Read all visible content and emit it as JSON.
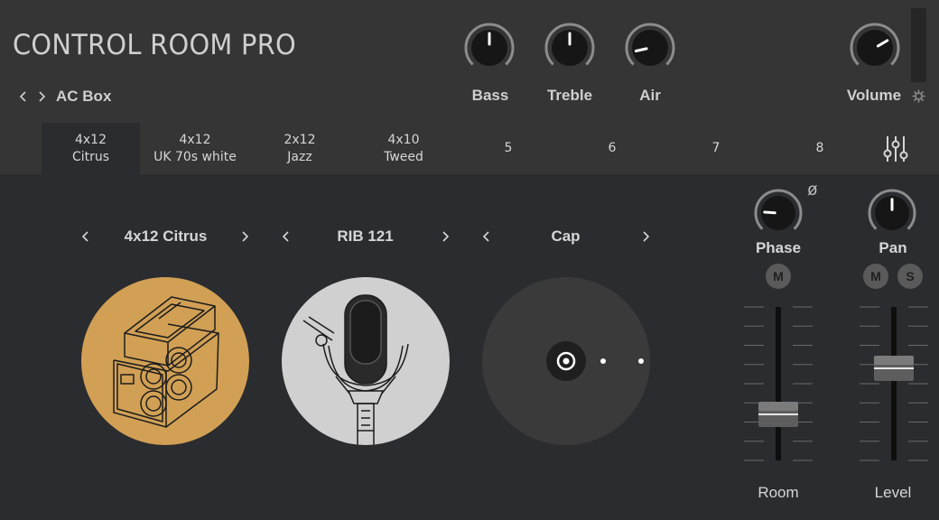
{
  "app": {
    "title": "CONTROL ROOM PRO"
  },
  "preset": {
    "name": "AC Box",
    "prev_icon": "chevron-left-icon",
    "next_icon": "chevron-right-icon"
  },
  "knobs": [
    {
      "id": "bass",
      "label": "Bass",
      "value": 0.5
    },
    {
      "id": "treble",
      "label": "Treble",
      "value": 0.5
    },
    {
      "id": "air",
      "label": "Air",
      "value": 0.12
    },
    {
      "id": "volume",
      "label": "Volume",
      "value": 0.72
    }
  ],
  "tabs": [
    {
      "line1": "4x12",
      "line2": "Citrus",
      "active": true
    },
    {
      "line1": "4x12",
      "line2": "UK 70s white",
      "active": false
    },
    {
      "line1": "2x12",
      "line2": "Jazz",
      "active": false
    },
    {
      "line1": "4x10",
      "line2": "Tweed",
      "active": false
    },
    {
      "line1": "5",
      "line2": "",
      "active": false
    },
    {
      "line1": "6",
      "line2": "",
      "active": false
    },
    {
      "line1": "7",
      "line2": "",
      "active": false
    },
    {
      "line1": "8",
      "line2": "",
      "active": false
    }
  ],
  "selectors": {
    "cabinet": "4x12 Citrus",
    "microphone": "RIB 121",
    "position": "Cap"
  },
  "channel": {
    "phase_label": "Phase",
    "phase_symbol": "ø",
    "pan_label": "Pan",
    "mute_label": "M",
    "solo_label": "S",
    "room_label": "Room",
    "level_label": "Level",
    "phase_knob_value": 0.18,
    "pan_knob_value": 0.5,
    "room_fader_value": 0.3,
    "level_fader_value": 0.6
  },
  "colors": {
    "accent_cabinet": "#d1a055",
    "mic_bg": "#d0d0d0",
    "position_bg": "#3a3a3a"
  },
  "icons": {
    "gear": "gear-icon",
    "mixer": "sliders-icon",
    "cabinet": "speaker-cabinet-icon",
    "microphone": "microphone-icon",
    "position": "mic-position-target-icon"
  }
}
